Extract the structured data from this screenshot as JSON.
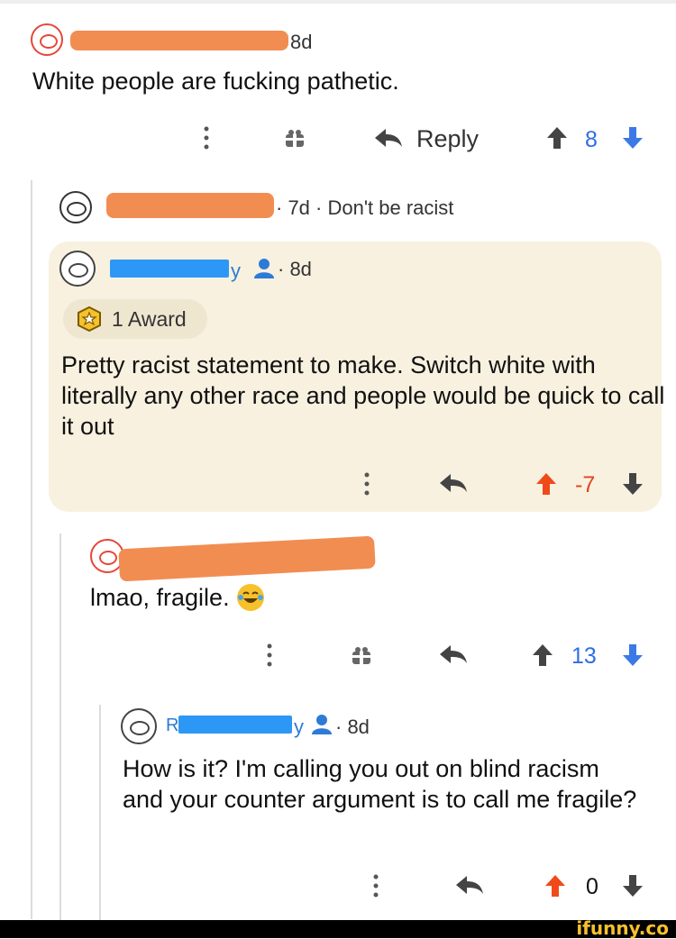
{
  "comments": [
    {
      "time": "8d",
      "body": "White people are fucking pathetic.",
      "reply_label": "Reply",
      "score": "8"
    },
    {
      "meta": "· 7d · Don't be racist"
    },
    {
      "user_suffix": "y",
      "time": "· 8d",
      "award": "1 Award",
      "body": "Pretty racist statement to make. Switch white with literally any other race and people would be quick to call it out",
      "score": "-7"
    },
    {
      "body": "lmao, fragile.",
      "score": "13"
    },
    {
      "user_prefix": "R",
      "user_suffix": "y",
      "time": "· 8d",
      "body": "How is it? I'm calling you out on blind racism and your counter argument is to call me fragile?",
      "score": "0"
    }
  ],
  "footer": {
    "brand": "ifunny.co"
  },
  "colors": {
    "redaction_orange": "#f28d52",
    "redaction_blue": "#2d97f5",
    "upvote_orange": "#f04a1a",
    "downvote_blue": "#3a79e6",
    "highlight_bg": "#f8f1e0",
    "footer_bg": "#000000",
    "brand_yellow": "#f6c12c"
  }
}
